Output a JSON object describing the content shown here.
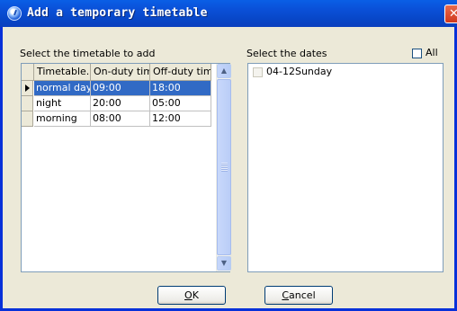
{
  "window": {
    "title": "Add a temporary timetable",
    "close_glyph": "✕"
  },
  "left_panel": {
    "label": "Select the timetable to add",
    "columns": [
      "Timetable...",
      "On-duty time",
      "Off-duty time"
    ],
    "rows": [
      {
        "name": "normal day",
        "on": "09:00",
        "off": "18:00"
      },
      {
        "name": "night",
        "on": "20:00",
        "off": "05:00"
      },
      {
        "name": "morning",
        "on": "08:00",
        "off": "12:00"
      }
    ],
    "selected_row_index": 0
  },
  "right_panel": {
    "label": "Select the dates",
    "all_label": "All",
    "dates": [
      {
        "label": "04-12Sunday"
      }
    ]
  },
  "buttons": {
    "ok": {
      "mnemonic": "O",
      "rest": "K"
    },
    "cancel": {
      "mnemonic": "C",
      "rest": "ancel"
    }
  },
  "colors": {
    "title_bar": "#0A5FE6",
    "selection": "#316AC5",
    "dialog_bg": "#ECE9D8"
  },
  "icons": [
    "clock-icon",
    "close-icon",
    "row-indicator-arrow-icon",
    "scroll-up-icon",
    "scroll-down-icon"
  ]
}
